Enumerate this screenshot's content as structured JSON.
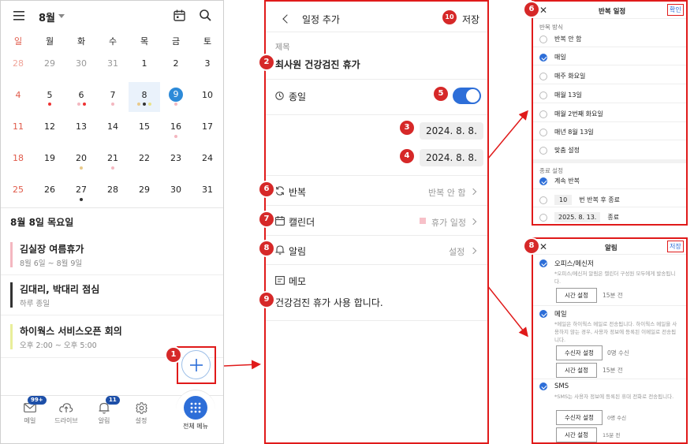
{
  "calendar": {
    "month": "8월",
    "weekdays": [
      "일",
      "월",
      "화",
      "수",
      "목",
      "금",
      "토"
    ],
    "weeks": [
      [
        "28",
        "29",
        "30",
        "31",
        "1",
        "2",
        "3"
      ],
      [
        "4",
        "5",
        "6",
        "7",
        "8",
        "9",
        "10"
      ],
      [
        "11",
        "12",
        "13",
        "14",
        "15",
        "16",
        "17"
      ],
      [
        "18",
        "19",
        "20",
        "21",
        "22",
        "23",
        "24"
      ],
      [
        "25",
        "26",
        "27",
        "28",
        "29",
        "30",
        "31"
      ]
    ],
    "selected_date_title": "8월 8일 목요일",
    "events": [
      {
        "title": "김실장 여름휴가",
        "time": "8월 6일 ~ 8월 9일",
        "color": "#f4b7c0"
      },
      {
        "title": "김대리, 박대리 점심",
        "time": "하루 종일",
        "color": "#333333"
      },
      {
        "title": "하이웍스 서비스오픈 회의",
        "time": "오후 2:00 ~ 오후 5:00",
        "color": "#e9ee9a"
      }
    ],
    "nav": [
      {
        "label": "메일",
        "badge": "99+",
        "icon": "mail-icon"
      },
      {
        "label": "드라이브",
        "badge": "",
        "icon": "cloud-icon"
      },
      {
        "label": "알림",
        "badge": "11",
        "icon": "bell-icon"
      },
      {
        "label": "설정",
        "badge": "",
        "icon": "gear-icon"
      },
      {
        "label": "전체 메뉴",
        "badge": "",
        "icon": "grid-icon"
      }
    ]
  },
  "form": {
    "title": "일정 추가",
    "save": "저장",
    "subject_label": "제목",
    "subject_value": "최사원 건강검진 휴가",
    "allday_label": "종일",
    "start_date": "2024. 8. 8.",
    "end_date": "2024. 8. 8.",
    "repeat_label": "반복",
    "repeat_value": "반복 안 함",
    "calendar_label": "캘린더",
    "calendar_value": "휴가 일정",
    "alarm_label": "알림",
    "alarm_value": "설정",
    "memo_label": "메모",
    "memo_value": "건강검진 휴가 사용 합니다."
  },
  "repeat": {
    "title": "반복 일정",
    "confirm": "확인",
    "method_label": "반복 방식",
    "options": [
      "반복 안 함",
      "매일",
      "매주 화요일",
      "매월 13일",
      "매월 2번째 화요일",
      "매년 8월 13일",
      "맞춤 설정"
    ],
    "end_label": "종료 설정",
    "end_options": [
      "계속 반복",
      "번 반복 후 종료",
      "종료"
    ],
    "end_count": "10",
    "end_date": "2025. 8. 13."
  },
  "alarm": {
    "title": "알림",
    "save": "저장",
    "sections": [
      {
        "name": "오피스/메신저",
        "desc": "*오피스/메신저 알림은 캘린더 구성원 모두에게 발송됩니다.",
        "buttons": [
          {
            "label": "시간 설정",
            "note": "15분 전"
          }
        ]
      },
      {
        "name": "메일",
        "desc": "*메일은 하이웍스 메일로 전송됩니다. 하이웍스 메일을 사용하지 않는 경우, 사용자 정보에 등록된 이메일로 전송됩니다.",
        "buttons": [
          {
            "label": "수신자 설정",
            "note": "0명 수신"
          },
          {
            "label": "시간 설정",
            "note": "15분 전"
          }
        ]
      },
      {
        "name": "SMS",
        "desc": "*SMS는 사용자 정보에 등록된 휴대 전화로 전송됩니다.",
        "buttons": [
          {
            "label": "수신자 설정",
            "note": "0명 수신"
          },
          {
            "label": "시간 설정",
            "note": "15분 전"
          }
        ]
      }
    ]
  },
  "markers": [
    "1",
    "2",
    "3",
    "4",
    "5",
    "6",
    "7",
    "8",
    "9",
    "10",
    "6",
    "8"
  ],
  "colors": {
    "accent": "#2d6ed8",
    "highlight": "#e01a1a",
    "sunday": "#e05a4a",
    "fab": "#2d6ed8"
  }
}
